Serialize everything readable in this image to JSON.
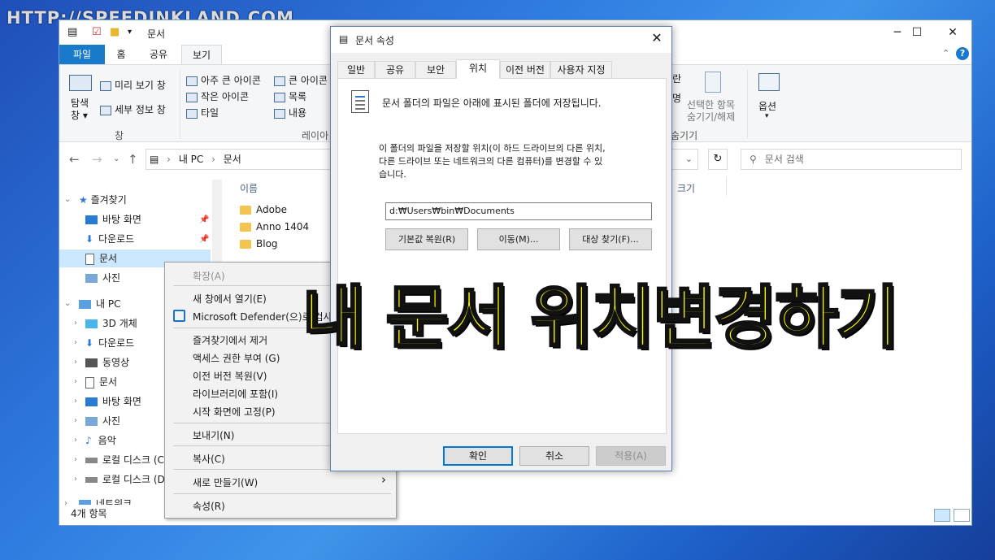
{
  "watermark": "HTTP://SPEEDINKLAND.COM",
  "explorer": {
    "title": "문서",
    "ribbon_tabs": [
      "파일",
      "홈",
      "공유",
      "보기"
    ],
    "ribbon": {
      "nav_pane": "탐색\n창 ▾",
      "preview": "미리 보기 창",
      "details": "세부 정보 창",
      "pane_group": "창",
      "xlarge_icons": "아주 큰 아이콘",
      "large_icons": "큰 아이콘",
      "small_icons": "작은 아이콘",
      "list": "목록",
      "tiles": "타일",
      "content": "내용",
      "layout_group": "레이아",
      "hide_selected_1": "선택한 항목",
      "hide_selected_2": "숨기기/해제",
      "options": "옵션",
      "show_hide_group": "숨기기",
      "cut_a": "란",
      "cut_b": "명"
    },
    "address": {
      "segments": [
        "내 PC",
        "문서"
      ],
      "search_placeholder": "문서 검색"
    },
    "nav": {
      "quick_access": "즐겨찾기",
      "desktop": "바탕 화면",
      "downloads": "다운로드",
      "documents": "문서",
      "pictures": "사진",
      "this_pc": "내 PC",
      "objects3d": "3D 개체",
      "pc_downloads": "다운로드",
      "videos": "동영상",
      "pc_documents": "문서",
      "pc_desktop": "바탕 화면",
      "pc_pictures": "사진",
      "music": "음악",
      "local_c": "로컬 디스크 (C",
      "local_d": "로컬 디스크 (D",
      "network": "네트워크"
    },
    "column_name": "이름",
    "column_cut": "크기",
    "files": [
      "Adobe",
      "Anno 1404",
      "Blog"
    ],
    "status": "4개 항목"
  },
  "context_menu": {
    "expand": "확장(A)",
    "open_new": "새 창에서 열기(E)",
    "defender": "Microsoft Defender(으)로 검사...",
    "remove_fav": "즐겨찾기에서 제거",
    "access": "액세스 권한 부여 (G)",
    "restore": "이전 버전 복원(V)",
    "library": "라이브러리에 포함(I)",
    "pin_start": "시작 화면에 고정(P)",
    "send_to": "보내기(N)",
    "copy": "복사(C)",
    "new": "새로 만들기(W)",
    "properties": "속성(R)"
  },
  "dialog": {
    "title": "문서 속성",
    "tabs": [
      "일반",
      "공유",
      "보안",
      "위치",
      "이전 버전",
      "사용자 지정"
    ],
    "info": "문서 폴더의 파일은 아래에 표시된 폴더에 저장됩니다.",
    "desc_1": "이 폴더의 파일을 저장할 위치(이 하드 드라이브의 다른 위치,",
    "desc_2": "다른 드라이브 또는 네트워크의 다른 컴퓨터)를 변경할 수 있",
    "desc_3": "습니다.",
    "path": "d:₩Users₩bin₩Documents",
    "restore_default": "기본값 복원(R)",
    "move": "이동(M)...",
    "find_target": "대상 찾기(F)...",
    "ok": "확인",
    "cancel": "취소",
    "apply": "적용(A)"
  },
  "overlay_text": "내 문서 위치변경하기",
  "colors": {
    "accent": "#1979ca",
    "overlay": "#ffff00",
    "selected": "#cce8ff"
  }
}
